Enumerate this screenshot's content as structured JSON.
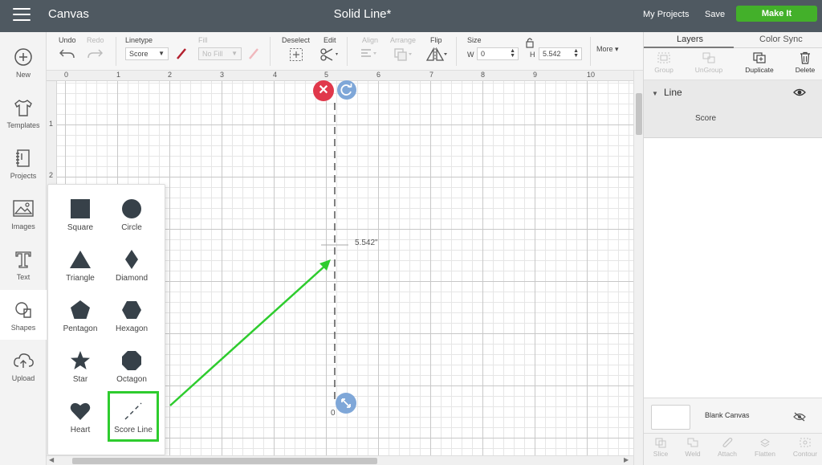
{
  "topbar": {
    "app_title": "Canvas",
    "doc_title": "Solid Line*",
    "my_projects": "My Projects",
    "save": "Save",
    "make_it": "Make It"
  },
  "leftbar": {
    "items": [
      {
        "label": "New",
        "icon": "plus-circle-icon"
      },
      {
        "label": "Templates",
        "icon": "tshirt-icon"
      },
      {
        "label": "Projects",
        "icon": "notebook-icon"
      },
      {
        "label": "Images",
        "icon": "image-icon"
      },
      {
        "label": "Text",
        "icon": "text-icon"
      },
      {
        "label": "Shapes",
        "icon": "shapes-icon"
      },
      {
        "label": "Upload",
        "icon": "upload-cloud-icon"
      }
    ]
  },
  "toolbar": {
    "undo": "Undo",
    "redo": "Redo",
    "linetype": "Linetype",
    "linetype_value": "Score",
    "fill": "Fill",
    "fill_value": "No Fill",
    "deselect": "Deselect",
    "edit": "Edit",
    "align": "Align",
    "arrange": "Arrange",
    "flip": "Flip",
    "size": "Size",
    "w_label": "W",
    "w_value": "0",
    "h_label": "H",
    "h_value": "5.542",
    "more": "More"
  },
  "rulers": {
    "top": [
      "0",
      "1",
      "2",
      "3",
      "4",
      "5",
      "6",
      "7",
      "8",
      "9",
      "10",
      "1"
    ],
    "left": [
      "1",
      "2"
    ]
  },
  "canvas": {
    "dimension_label": "5.542\"",
    "zero_label": "0"
  },
  "shapes_panel": {
    "items": [
      {
        "label": "Square"
      },
      {
        "label": "Circle"
      },
      {
        "label": "Triangle"
      },
      {
        "label": "Diamond"
      },
      {
        "label": "Pentagon"
      },
      {
        "label": "Hexagon"
      },
      {
        "label": "Star"
      },
      {
        "label": "Octagon"
      },
      {
        "label": "Heart"
      },
      {
        "label": "Score Line"
      }
    ]
  },
  "rightpanel": {
    "tabs": [
      "Layers",
      "Color Sync"
    ],
    "actions": [
      "Group",
      "UnGroup",
      "Duplicate",
      "Delete"
    ],
    "layer_name": "Line",
    "layer_child": "Score",
    "blank_canvas": "Blank Canvas",
    "bottom_actions": [
      "Slice",
      "Weld",
      "Attach",
      "Flatten",
      "Contour"
    ]
  },
  "colors": {
    "accent_green": "#43b02a",
    "highlight_green": "#2ecc2e",
    "topbar": "#4f5961",
    "delete_red": "#e0384b",
    "handle_blue": "#7fa7d8"
  }
}
